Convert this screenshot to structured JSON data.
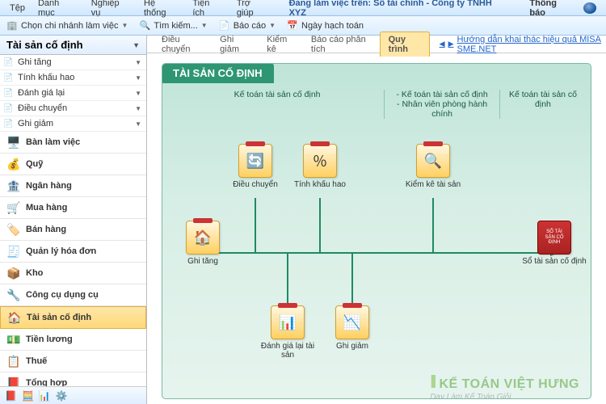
{
  "menu": {
    "items": [
      "Tệp",
      "Danh mục",
      "Nghiệp vụ",
      "Hệ thống",
      "Tiện ích",
      "Trợ giúp"
    ],
    "status": "Đang làm việc trên: Sổ tài chính - Công ty TNHH XYZ",
    "thongbao": "Thông báo"
  },
  "toolbar": {
    "items": [
      "Chọn chi nhánh làm việc",
      "Tìm kiếm...",
      "Báo cáo",
      "Ngày hạch toán"
    ],
    "icons": [
      "🏢",
      "🔍",
      "📄",
      "📅"
    ]
  },
  "sidebar": {
    "title": "Tài sản cố định",
    "subitems": [
      "Ghi tăng",
      "Tính khấu hao",
      "Đánh giá lại",
      "Điều chuyển",
      "Ghi giảm"
    ],
    "nav": [
      {
        "icon": "🖥️",
        "label": "Bàn làm việc"
      },
      {
        "icon": "💰",
        "label": "Quỹ"
      },
      {
        "icon": "🏦",
        "label": "Ngân hàng"
      },
      {
        "icon": "🛒",
        "label": "Mua hàng"
      },
      {
        "icon": "🏷️",
        "label": "Bán hàng"
      },
      {
        "icon": "🧾",
        "label": "Quản lý hóa đơn"
      },
      {
        "icon": "📦",
        "label": "Kho"
      },
      {
        "icon": "🔧",
        "label": "Công cụ dụng cụ"
      },
      {
        "icon": "🏠",
        "label": "Tài sản cố định"
      },
      {
        "icon": "💵",
        "label": "Tiền lương"
      },
      {
        "icon": "📋",
        "label": "Thuế"
      },
      {
        "icon": "📕",
        "label": "Tổng hợp"
      }
    ],
    "active_index": 8
  },
  "tabs": {
    "items": [
      "Điều chuyển",
      "Ghi giảm",
      "Kiểm kê",
      "Báo cáo phân tích",
      "Quy trình"
    ],
    "active_index": 4,
    "help_link": "Hướng dẫn khai thác hiệu quả MISA SME.NET"
  },
  "panel": {
    "title": "TÀI SẢN CỐ ĐỊNH",
    "columns": {
      "c1": "Kế toán tài sản cố định",
      "c2a": "- Kế toán tài sản cố định",
      "c2b": "- Nhân viên phòng hành chính",
      "c3": "Kế toán tài sản cố định"
    },
    "nodes": {
      "ghi_tang": "Ghi tăng",
      "dieu_chuyen": "Điều chuyển",
      "tinh_khau_hao": "Tính khấu hao",
      "danh_gia_lai": "Đánh giá lại tài sản",
      "ghi_giam": "Ghi giảm",
      "kiem_ke": "Kiểm kê tài sản",
      "so": "Sổ tài sản cố định",
      "so_icon": "SỔ TÀI SẢN CỐ ĐỊNH"
    }
  },
  "watermark": {
    "line1": "KẾ TOÁN VIỆT HƯNG",
    "line2": "Dạy Làm Kế Toán Giỏi"
  }
}
